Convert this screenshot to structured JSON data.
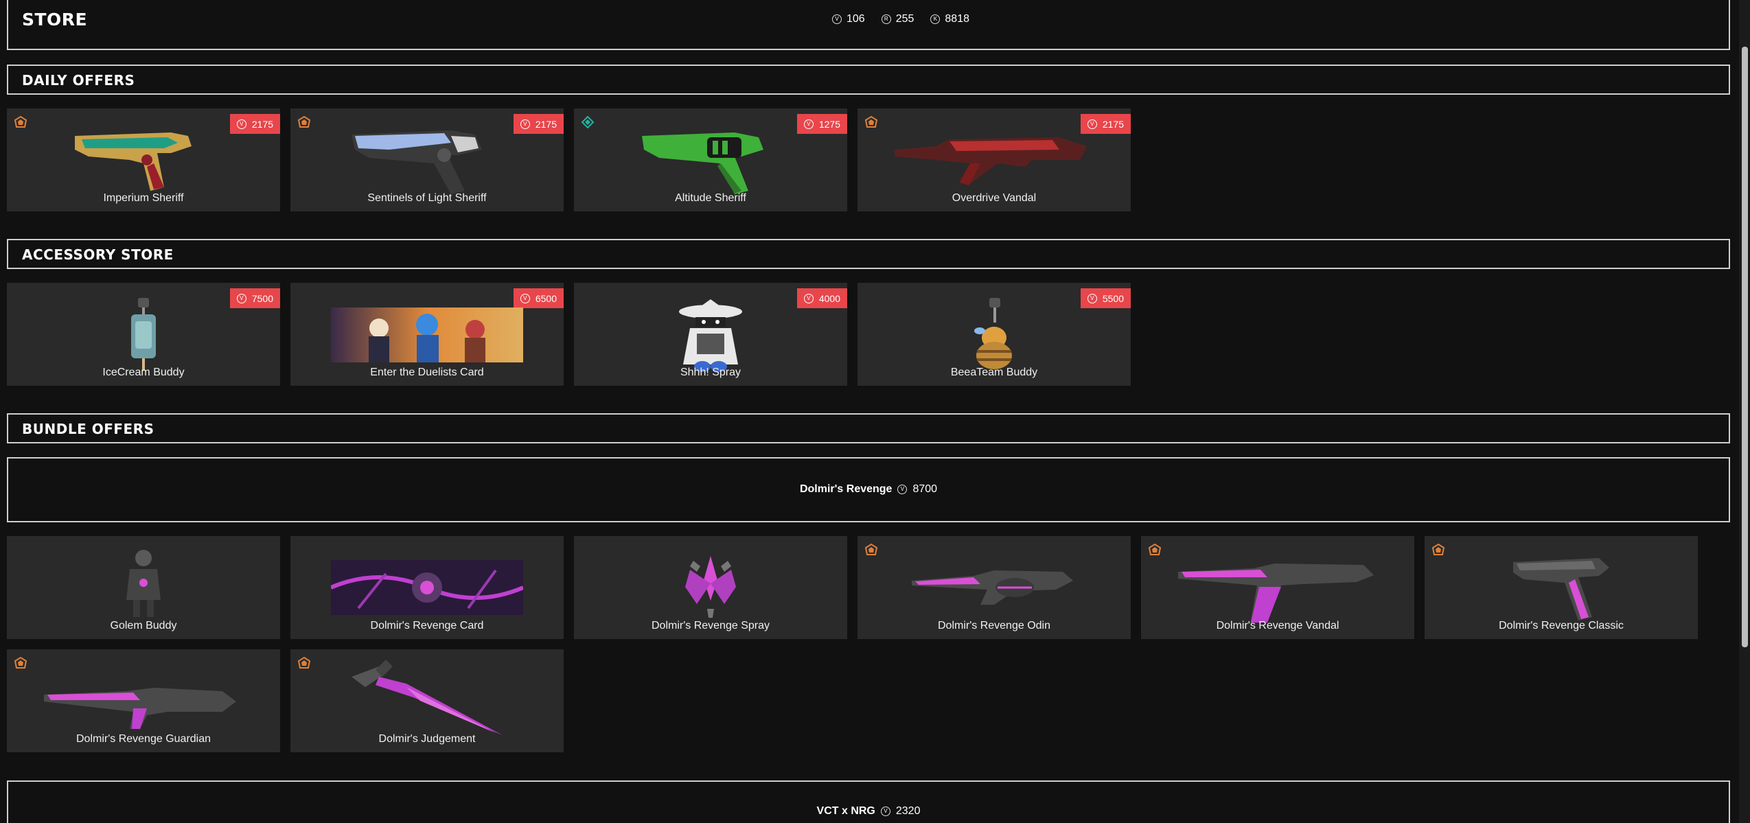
{
  "header": {
    "title": "STORE",
    "wallet": [
      {
        "icon": "valorant-points-icon",
        "symbol": "V",
        "amount": "106"
      },
      {
        "icon": "radianite-icon",
        "symbol": "R",
        "amount": "255"
      },
      {
        "icon": "kingdom-credits-icon",
        "symbol": "K",
        "amount": "8818"
      }
    ]
  },
  "daily": {
    "title": "DAILY OFFERS",
    "items": [
      {
        "name": "Imperium Sheriff",
        "price": "2175",
        "tier": "premium-tier-icon",
        "tier_color": "#e0803a"
      },
      {
        "name": "Sentinels of Light Sheriff",
        "price": "2175",
        "tier": "premium-tier-icon",
        "tier_color": "#e0803a"
      },
      {
        "name": "Altitude Sheriff",
        "price": "1275",
        "tier": "select-tier-icon",
        "tier_color": "#1fb5a3"
      },
      {
        "name": "Overdrive Vandal",
        "price": "2175",
        "tier": "premium-tier-icon",
        "tier_color": "#e0803a"
      }
    ]
  },
  "accessory": {
    "title": "ACCESSORY STORE",
    "items": [
      {
        "name": "IceCream Buddy",
        "price": "7500"
      },
      {
        "name": "Enter the Duelists Card",
        "price": "6500"
      },
      {
        "name": "Shhh! Spray",
        "price": "4000"
      },
      {
        "name": "BeeaTeam Buddy",
        "price": "5500"
      }
    ]
  },
  "bundles": {
    "title": "BUNDLE OFFERS",
    "bundle1": {
      "name": "Dolmir's Revenge",
      "price": "8700",
      "items": [
        {
          "name": "Golem Buddy"
        },
        {
          "name": "Dolmir's Revenge Card"
        },
        {
          "name": "Dolmir's Revenge Spray"
        },
        {
          "name": "Dolmir's Revenge Odin",
          "tier": "premium-tier-icon"
        },
        {
          "name": "Dolmir's Revenge Vandal",
          "tier": "premium-tier-icon"
        },
        {
          "name": "Dolmir's Revenge Classic",
          "tier": "premium-tier-icon"
        },
        {
          "name": "Dolmir's Revenge Guardian",
          "tier": "premium-tier-icon"
        },
        {
          "name": "Dolmir's Judgement",
          "tier": "premium-tier-icon"
        }
      ]
    },
    "bundle2": {
      "name": "VCT x NRG",
      "price": "2320"
    }
  },
  "colors": {
    "background": "#111111",
    "tile": "#2a2a2a",
    "price_badge": "#e8464b",
    "accent_magenta": "#d94fd6",
    "premium_tier": "#e0803a",
    "select_tier": "#1fb5a3"
  }
}
